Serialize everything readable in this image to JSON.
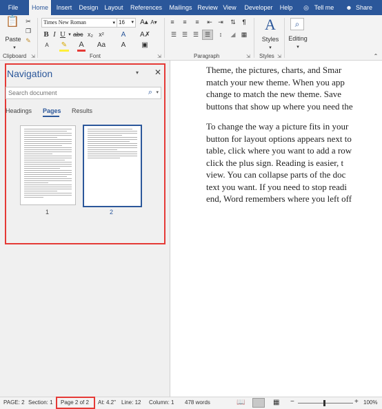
{
  "tabs": [
    "File",
    "Home",
    "Insert",
    "Design",
    "Layout",
    "References",
    "Mailings",
    "Review",
    "View",
    "Developer",
    "Help",
    "Tell me",
    "Share"
  ],
  "active_tab": "Home",
  "ribbon": {
    "paste_label": "Paste",
    "font_name": "Times New Roman",
    "font_size": "16",
    "styles_label": "Styles",
    "editing_label": "Editing",
    "groups": [
      "Clipboard",
      "Font",
      "Paragraph",
      "Styles"
    ]
  },
  "navigation": {
    "title": "Navigation",
    "search_placeholder": "Search document",
    "tabs": [
      "Headings",
      "Pages",
      "Results"
    ],
    "active_tab": "Pages",
    "pages": [
      "1",
      "2"
    ],
    "selected_page": "2"
  },
  "document": {
    "paragraphs": [
      [
        "Theme, the pictures, charts, and Smar",
        "match your new theme. When you app",
        "change to match the new theme. Save",
        "buttons that show up where you need the"
      ],
      [
        "To change the way a picture fits in your",
        "button for layout options appears next to",
        "table, click where you want to add a row",
        "click the plus sign. Reading is easier, t",
        "view. You can collapse parts of the doc",
        "text you want. If you need to stop readi",
        "end, Word remembers where you left off"
      ]
    ]
  },
  "status": {
    "page": "PAGE: 2",
    "section": "Section: 1",
    "page_of": "Page 2 of 2",
    "at": "At: 4.2\"",
    "line": "Line: 12",
    "column": "Column: 1",
    "words": "478 words",
    "zoom": "100%"
  },
  "colors": {
    "accent": "#2b579a",
    "highlight": "#e53935"
  }
}
